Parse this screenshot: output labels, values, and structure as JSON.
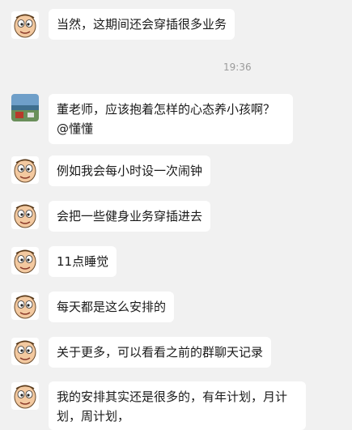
{
  "timestamp": "19:36",
  "messages": [
    {
      "text": "当然，这期间还会穿插很多业务",
      "avatar": "cartoon-face"
    },
    {
      "text": "董老师，应该抱着怎样的心态养小孩啊？@懂懂",
      "avatar": "landscape-photo"
    },
    {
      "text": "例如我会每小时设一次闹钟",
      "avatar": "cartoon-face"
    },
    {
      "text": "会把一些健身业务穿插进去",
      "avatar": "cartoon-face"
    },
    {
      "text": "11点睡觉",
      "avatar": "cartoon-face"
    },
    {
      "text": "每天都是这么安排的",
      "avatar": "cartoon-face"
    },
    {
      "text": "关于更多，可以看看之前的群聊天记录",
      "avatar": "cartoon-face"
    },
    {
      "text": "我的安排其实还是很多的，有年计划，月计划，周计划，",
      "avatar": "cartoon-face"
    }
  ]
}
